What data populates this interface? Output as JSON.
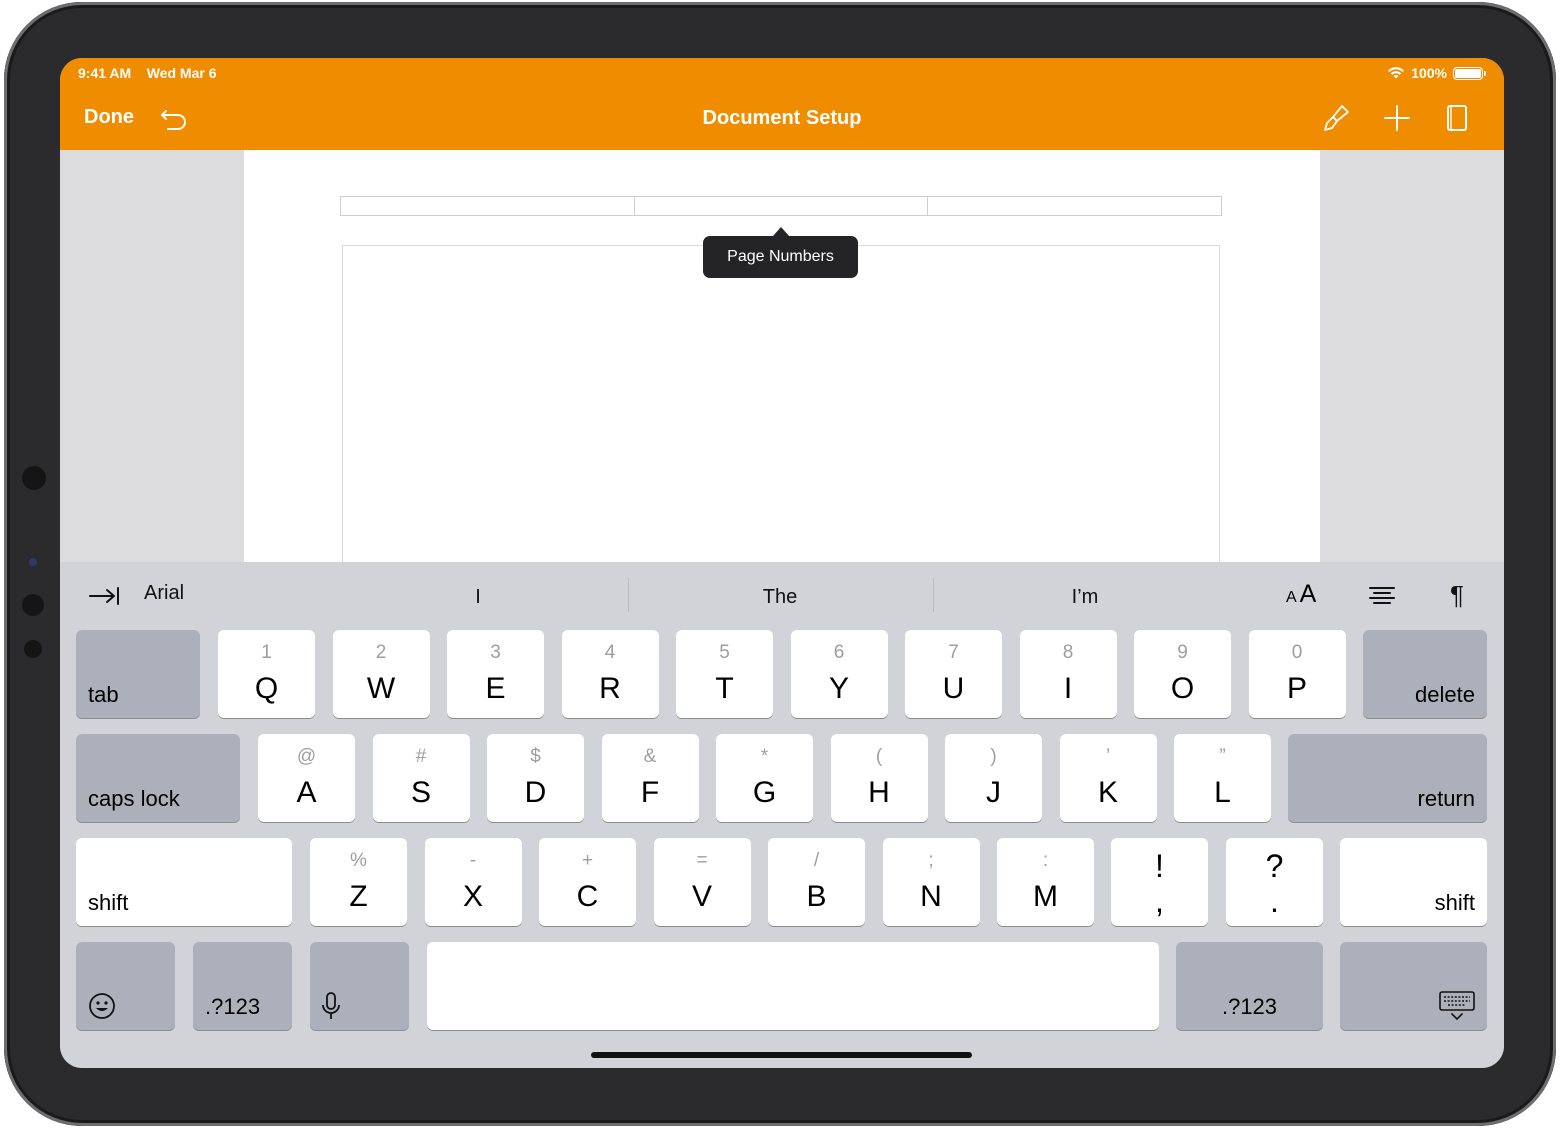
{
  "status_bar": {
    "time": "9:41 AM",
    "date": "Wed Mar 6",
    "battery": "100%"
  },
  "toolbar": {
    "done_label": "Done",
    "title": "Document Setup",
    "icons": [
      "undo-icon",
      "paintbrush-icon",
      "plus-icon",
      "page-icon"
    ]
  },
  "document": {
    "tooltip": "Page Numbers"
  },
  "shortcut_bar": {
    "font": "Arial",
    "suggestions": [
      "I",
      "The",
      "I’m"
    ],
    "font_size_label": "A A",
    "icons": [
      "tab-arrow-icon",
      "font-size-icon",
      "align-icon",
      "pilcrow-icon"
    ]
  },
  "keyboard": {
    "row1": [
      {
        "main": "Q",
        "sub": "1"
      },
      {
        "main": "W",
        "sub": "2"
      },
      {
        "main": "E",
        "sub": "3"
      },
      {
        "main": "R",
        "sub": "4"
      },
      {
        "main": "T",
        "sub": "5"
      },
      {
        "main": "Y",
        "sub": "6"
      },
      {
        "main": "U",
        "sub": "7"
      },
      {
        "main": "I",
        "sub": "8"
      },
      {
        "main": "O",
        "sub": "9"
      },
      {
        "main": "P",
        "sub": "0"
      }
    ],
    "row2": [
      {
        "main": "A",
        "sub": "@"
      },
      {
        "main": "S",
        "sub": "#"
      },
      {
        "main": "D",
        "sub": "$"
      },
      {
        "main": "F",
        "sub": "&"
      },
      {
        "main": "G",
        "sub": "*"
      },
      {
        "main": "H",
        "sub": "("
      },
      {
        "main": "J",
        "sub": ")"
      },
      {
        "main": "K",
        "sub": "’"
      },
      {
        "main": "L",
        "sub": "”"
      }
    ],
    "row3": [
      {
        "main": "Z",
        "sub": "%"
      },
      {
        "main": "X",
        "sub": "-"
      },
      {
        "main": "C",
        "sub": "+"
      },
      {
        "main": "V",
        "sub": "="
      },
      {
        "main": "B",
        "sub": "/"
      },
      {
        "main": "N",
        "sub": ";"
      },
      {
        "main": "M",
        "sub": ":"
      }
    ],
    "punct": [
      {
        "top": "!",
        "bottom": ","
      },
      {
        "top": "?",
        "bottom": "."
      }
    ],
    "tab_label": "tab",
    "delete_label": "delete",
    "caps_label": "caps lock",
    "return_label": "return",
    "shift_label": "shift",
    "numbers_label": ".?123"
  }
}
